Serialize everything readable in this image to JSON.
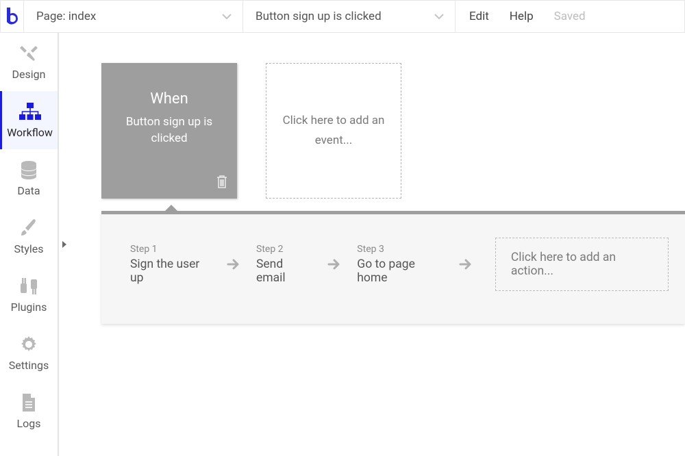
{
  "topbar": {
    "page_selector": "Page: index",
    "workflow_selector": "Button sign up is clicked",
    "edit": "Edit",
    "help": "Help",
    "saved": "Saved"
  },
  "sidebar": {
    "items": [
      {
        "label": "Design"
      },
      {
        "label": "Workflow"
      },
      {
        "label": "Data"
      },
      {
        "label": "Styles"
      },
      {
        "label": "Plugins"
      },
      {
        "label": "Settings"
      },
      {
        "label": "Logs"
      }
    ]
  },
  "canvas": {
    "event": {
      "when": "When",
      "desc": "Button sign up is clicked"
    },
    "add_event_placeholder": "Click here to add an event...",
    "steps": [
      {
        "label": "Step 1",
        "title": "Sign the user up"
      },
      {
        "label": "Step 2",
        "title": "Send email"
      },
      {
        "label": "Step 3",
        "title": "Go to page home"
      }
    ],
    "add_action_placeholder": "Click here to add an action..."
  }
}
